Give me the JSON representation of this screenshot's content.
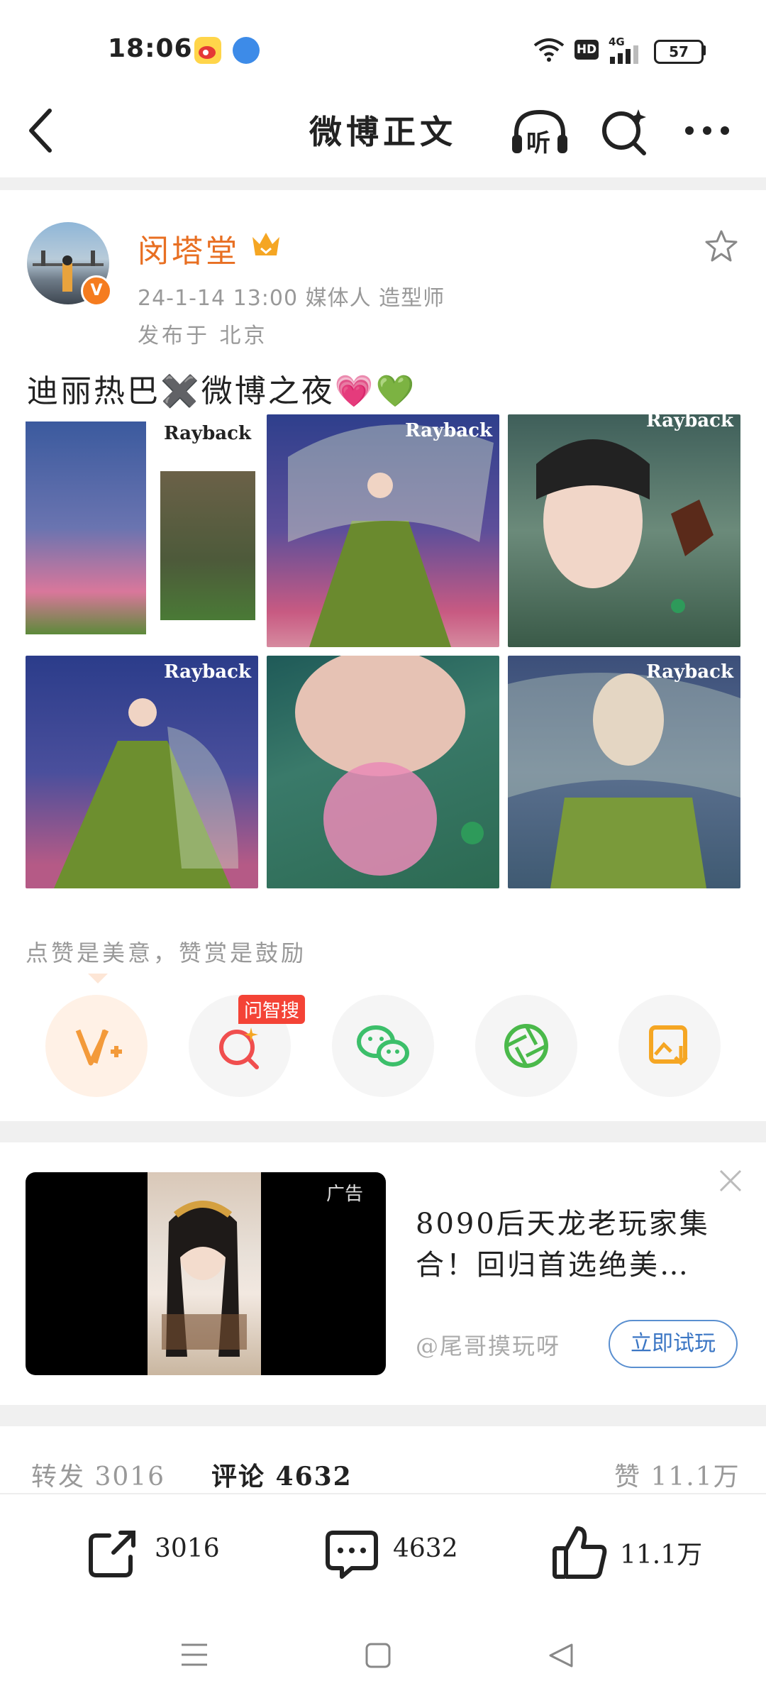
{
  "status_bar": {
    "time": "18:06",
    "battery": "57",
    "network": "4G",
    "hd": "HD"
  },
  "nav": {
    "title": "微博正文",
    "listen_label": "听"
  },
  "post": {
    "author": "闵塔堂",
    "timestamp_meta": "24-1-14 13:00  媒体人 造型师",
    "location": "发布于 北京",
    "text": "迪丽热巴✖️微博之夜💗💚",
    "images": [
      {
        "brand": "Rayback"
      },
      {
        "brand": "Rayback"
      },
      {
        "brand": "Rayback"
      },
      {
        "brand": "Rayback"
      },
      {
        "brand": ""
      },
      {
        "brand": "Rayback"
      }
    ]
  },
  "appreciation": {
    "text": "点赞是美意，赞赏是鼓励",
    "badge": "问智搜"
  },
  "ad": {
    "label": "广告",
    "title": "8090后天龙老玩家集合！回归首选绝美…",
    "source": "@尾哥摸玩呀",
    "button": "立即试玩"
  },
  "tabs": {
    "repost": "转发 3016",
    "comment": "评论 4632",
    "like": "赞 11.1万"
  },
  "actions": {
    "repost_count": "3016",
    "comment_count": "4632",
    "like_count": "11.1万"
  },
  "colors": {
    "accent_orange": "#e86f22",
    "link_blue": "#3b76c4",
    "ad_badge_red": "#f44336"
  }
}
